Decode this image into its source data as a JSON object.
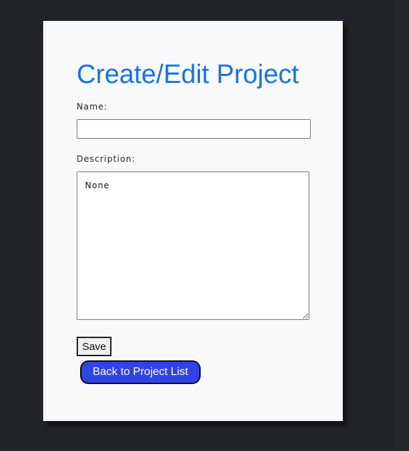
{
  "page": {
    "title": "Create/Edit Project"
  },
  "form": {
    "name_label": "Name:",
    "name_value": "",
    "description_label": "Description:",
    "description_value": "None",
    "save_label": "Save",
    "back_label": "Back to Project List"
  },
  "colors": {
    "background": "#212429",
    "card": "#f8f9fa",
    "title": "#1673e8",
    "back_button": "#3143e6"
  }
}
